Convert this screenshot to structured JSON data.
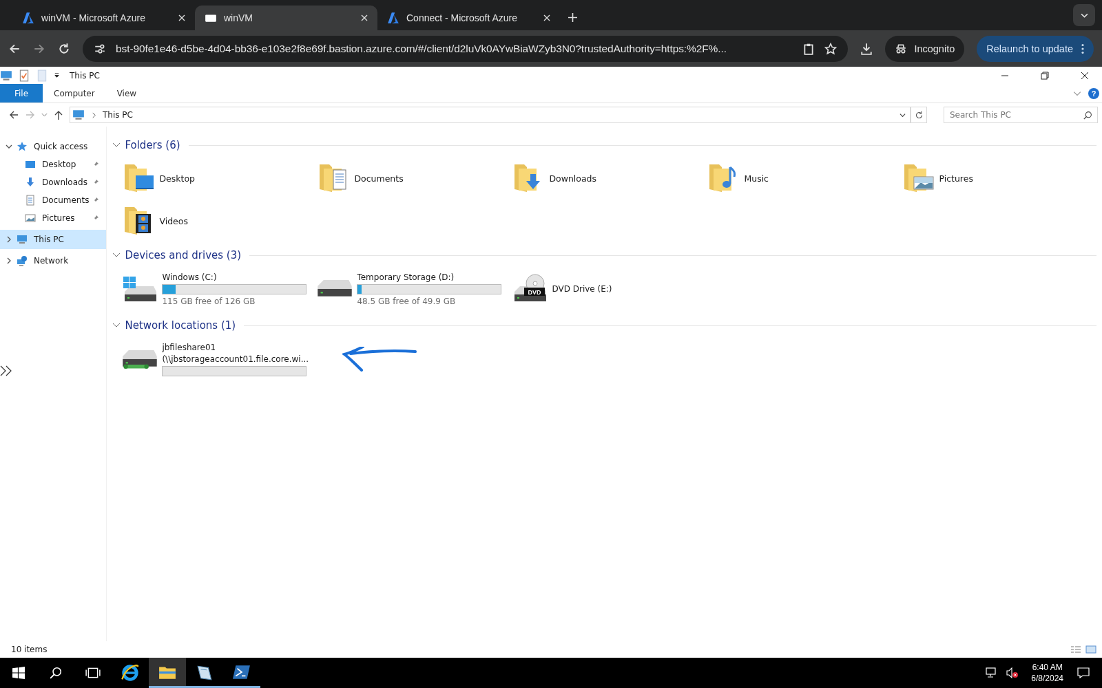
{
  "browser": {
    "tabs": [
      {
        "title": "winVM - Microsoft Azure",
        "selected": false,
        "kind": "azure"
      },
      {
        "title": "winVM",
        "selected": true,
        "kind": "vm"
      },
      {
        "title": "Connect - Microsoft Azure",
        "selected": false,
        "kind": "azure"
      }
    ],
    "url": "bst-90fe1e46-d5be-4d04-bb36-e103e2f8e69f.bastion.azure.com/#/client/d2luVk0AYwBiaWZyb3N0?trustedAuthority=https:%2F%...",
    "incognito": "Incognito",
    "relaunch": "Relaunch to update"
  },
  "window": {
    "title": "This PC"
  },
  "help_button": "?",
  "ribbon_tabs": [
    {
      "label": "File",
      "kind": "file"
    },
    {
      "label": "Computer",
      "kind": "tab"
    },
    {
      "label": "View",
      "kind": "tab"
    }
  ],
  "address": {
    "path": "This PC",
    "search": {
      "placeholder": "Search This PC"
    }
  },
  "sidebar": {
    "items": [
      {
        "label": "Quick access",
        "kind": "star",
        "expanded": true,
        "selected": false,
        "children": [
          {
            "label": "Desktop",
            "kind": "desktop",
            "pinned": true
          },
          {
            "label": "Downloads",
            "kind": "downloads",
            "pinned": true
          },
          {
            "label": "Documents",
            "kind": "documents",
            "pinned": true
          },
          {
            "label": "Pictures",
            "kind": "pictures",
            "pinned": true
          }
        ]
      },
      {
        "label": "This PC",
        "kind": "pc",
        "expanded": false,
        "selected": true
      },
      {
        "label": "Network",
        "kind": "network",
        "expanded": false,
        "selected": false
      }
    ]
  },
  "sections": [
    {
      "title": "Folders (6)",
      "expanded": true,
      "kind": "folders",
      "items": [
        {
          "name": "Desktop",
          "kind": "desktop"
        },
        {
          "name": "Documents",
          "kind": "documents"
        },
        {
          "name": "Downloads",
          "kind": "downloads"
        },
        {
          "name": "Music",
          "kind": "music"
        },
        {
          "name": "Pictures",
          "kind": "pictures"
        },
        {
          "name": "Videos",
          "kind": "videos"
        }
      ]
    },
    {
      "title": "Devices and drives (3)",
      "expanded": true,
      "kind": "drives",
      "items": [
        {
          "name": "Windows (C:)",
          "kind": "system",
          "level": 0.087,
          "free": "115 GB free of 126 GB"
        },
        {
          "name": "Temporary Storage (D:)",
          "kind": "disk",
          "level": 0.028,
          "free": "48.5 GB free of 49.9 GB"
        },
        {
          "name": "DVD Drive (E:)",
          "kind": "dvd",
          "dvd_label": "DVD"
        }
      ]
    },
    {
      "title": "Network locations (1)",
      "expanded": true,
      "kind": "drives",
      "items": [
        {
          "name": "jbfileshare01",
          "path": "(\\\\jbstorageaccount01.file.core.wi...",
          "kind": "share"
        }
      ]
    }
  ],
  "status_bar": {
    "count": "10 items"
  },
  "taskbar": {
    "time": "6:40 AM",
    "date": "6/8/2024"
  }
}
